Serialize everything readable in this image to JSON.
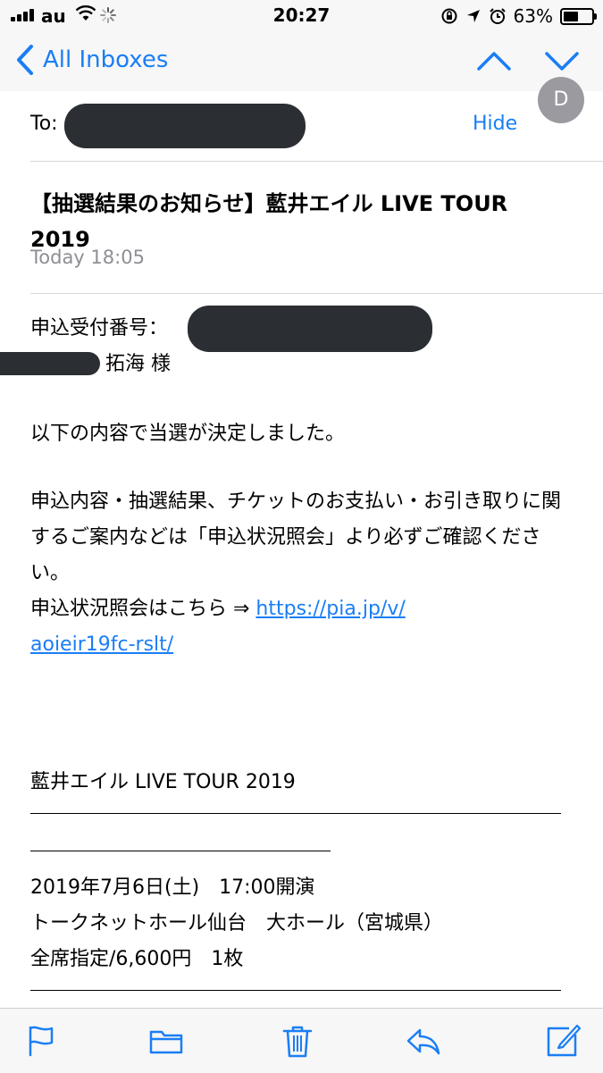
{
  "status_bar": {
    "carrier": "au",
    "time": "20:27",
    "battery_text": "63%",
    "battery_level": 0.63
  },
  "nav": {
    "back_label": "All Inboxes"
  },
  "header": {
    "avatar_initial": "D",
    "to_label": "To:",
    "hide_label": "Hide",
    "subject": "【抽選結果のお知らせ】藍井エイル LIVE TOUR 2019",
    "date": "Today 18:05"
  },
  "body": {
    "app_number_label": "申込受付番号：",
    "recipient_suffix": "拓海 様",
    "line1": "以下の内容で当選が決定しました。",
    "para2": "申込内容・抽選結果、チケットのお支払い・お引き取りに関するご案内などは「申込状況照会」より必ずご確認ください。",
    "status_prefix": "申込状況照会はこちら ⇒ ",
    "link_part1": "https://pia.jp/v/",
    "link_part2": "aoieir19fc-rslt/",
    "event_title": "藍井エイル LIVE TOUR 2019",
    "event_date": "2019年7月6日(土)　17:00開演",
    "venue": "トークネットホール仙台　大ホール（宮城県）",
    "seat": "全席指定/6,600円　1枚"
  },
  "colors": {
    "accent": "#1a7ef5",
    "redaction": "#2b2e33",
    "secondary_text": "#8e8e93"
  },
  "toolbar": {
    "icons": [
      "flag-icon",
      "folder-icon",
      "trash-icon",
      "reply-icon",
      "compose-icon"
    ]
  }
}
